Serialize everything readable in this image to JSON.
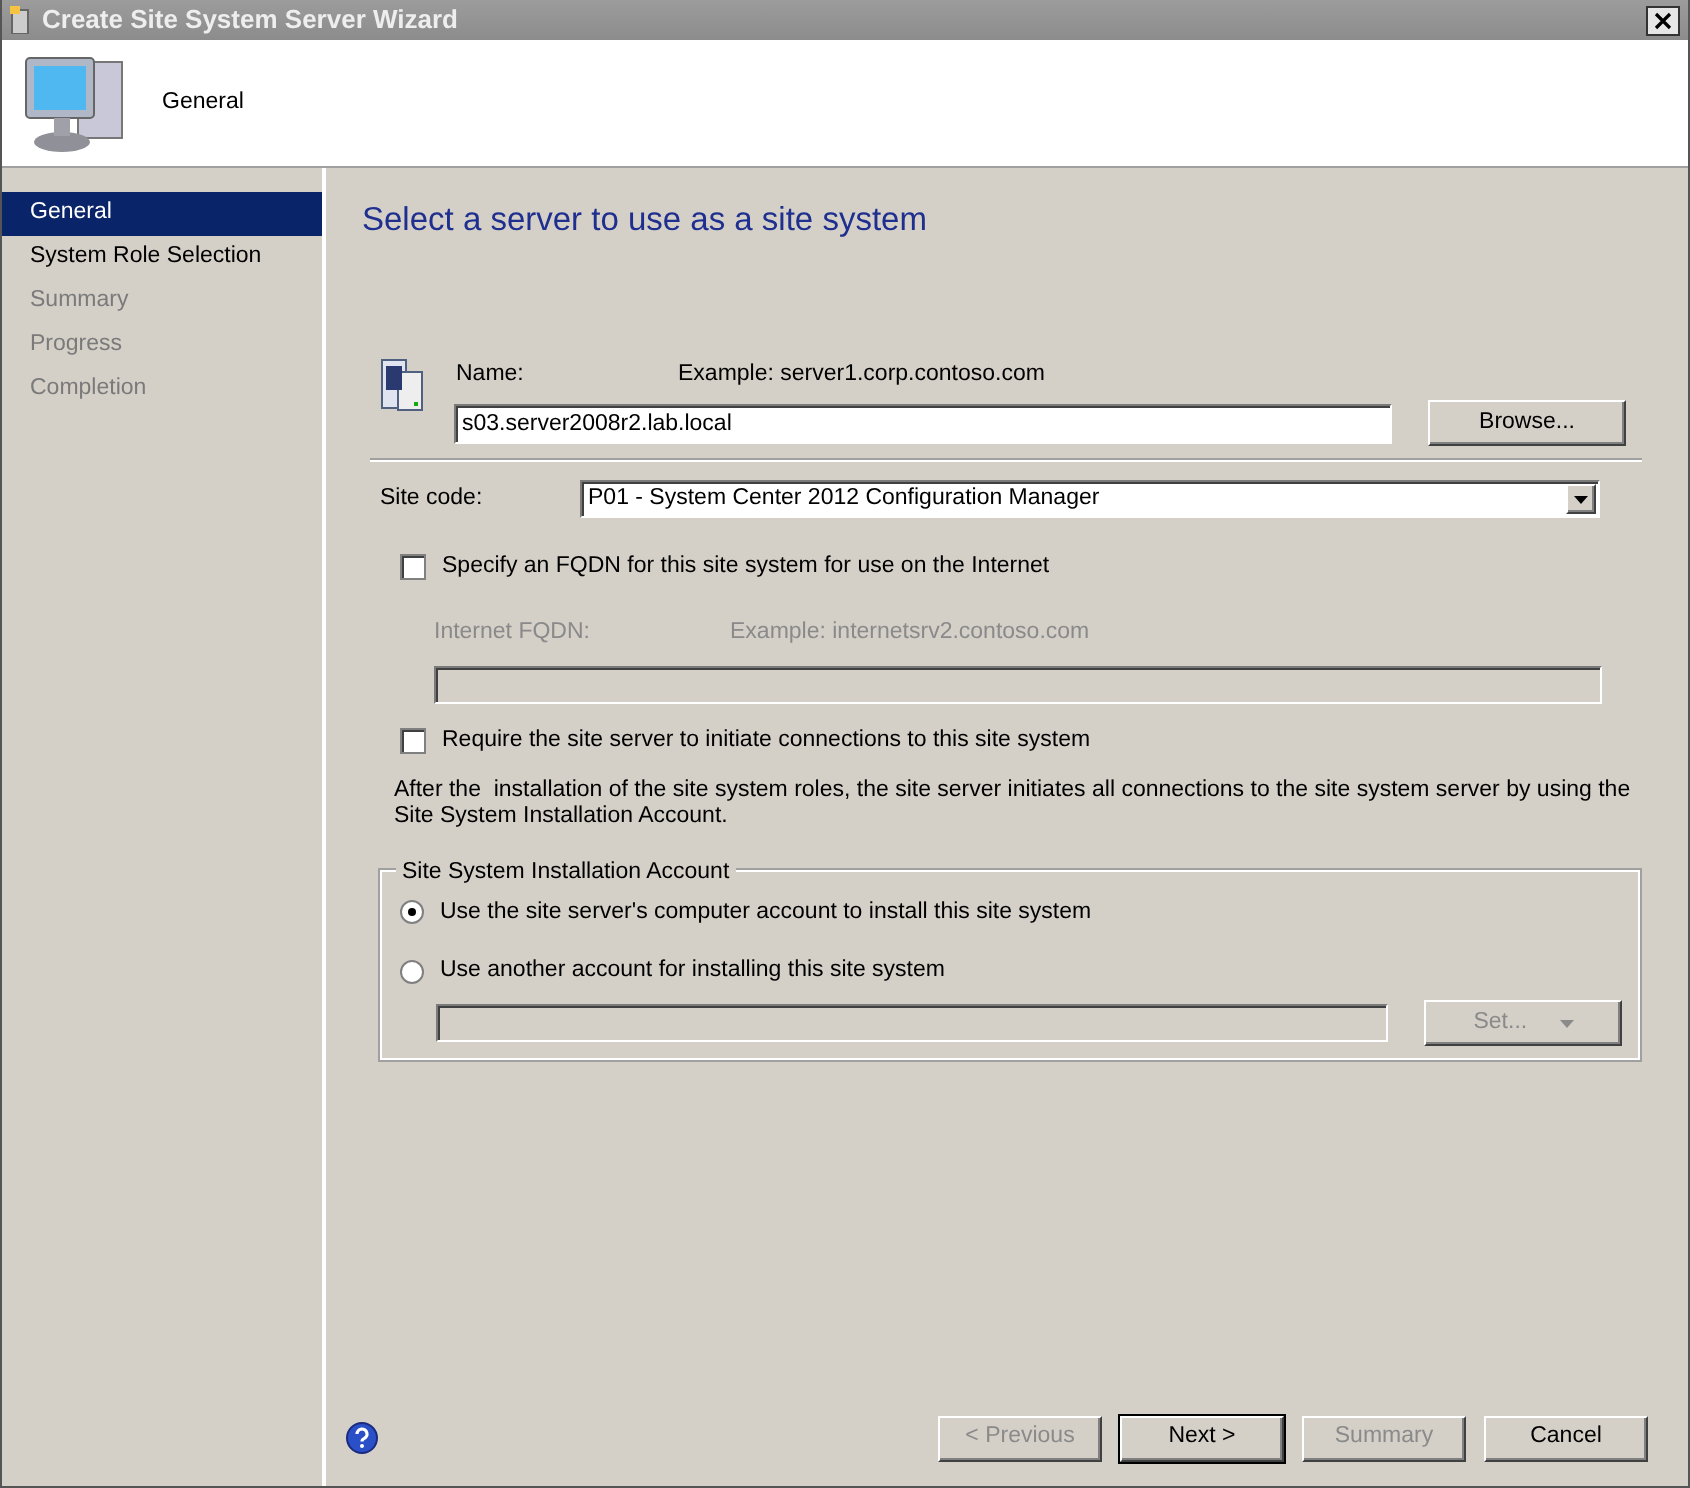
{
  "window": {
    "title": "Create Site System Server Wizard"
  },
  "header": {
    "title": "General"
  },
  "steps": [
    {
      "label": "General",
      "selected": true,
      "disabled": false
    },
    {
      "label": "System Role Selection",
      "selected": false,
      "disabled": false
    },
    {
      "label": "Summary",
      "selected": false,
      "disabled": true
    },
    {
      "label": "Progress",
      "selected": false,
      "disabled": true
    },
    {
      "label": "Completion",
      "selected": false,
      "disabled": true
    }
  ],
  "heading": "Select a server to use as a site system",
  "name_field": {
    "label": "Name:",
    "example": "Example: server1.corp.contoso.com",
    "value": "s03.server2008r2.lab.local"
  },
  "browse_button": "Browse...",
  "site_code": {
    "label": "Site code:",
    "value": "P01 - System Center 2012 Configuration Manager"
  },
  "fqdn_checkbox": {
    "label": "Specify an FQDN for this site system for use on the Internet",
    "checked": false
  },
  "internet_fqdn": {
    "label": "Internet FQDN:",
    "example": "Example: internetsrv2.contoso.com",
    "disabled": true
  },
  "require_checkbox": {
    "label": "Require the site server to initiate connections to this site system",
    "checked": false
  },
  "note": "After the  installation of the site system roles, the site server initiates all connections to the site system server by using the Site System Installation Account.",
  "install_account": {
    "legend": "Site System Installation Account",
    "options": [
      {
        "label": "Use the site server's computer account to install this site system",
        "selected": true
      },
      {
        "label": "Use another account for installing this site system",
        "selected": false
      }
    ],
    "account_field": {
      "disabled": true
    },
    "set_button": {
      "label": "Set...",
      "disabled": true
    }
  },
  "footer_buttons": [
    {
      "label": "< Previous",
      "disabled": true,
      "default": false
    },
    {
      "label": "Next >",
      "disabled": false,
      "default": true
    },
    {
      "label": "Summary",
      "disabled": true,
      "default": false
    },
    {
      "label": "Cancel",
      "disabled": false,
      "default": false
    }
  ]
}
